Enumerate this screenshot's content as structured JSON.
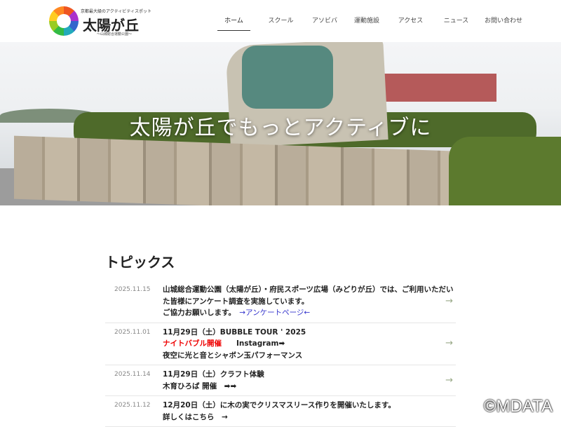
{
  "logo": {
    "tagline": "京都最大級のアクティビティスポット",
    "title": "太陽が丘",
    "subtitle": "〜山城総合運動公園〜"
  },
  "nav": [
    "ホーム",
    "スクール",
    "アソビバ",
    "運動施設",
    "アクセス",
    "ニュース",
    "お問い合わせ"
  ],
  "hero": {
    "text": "太陽が丘でもっとアクティブに"
  },
  "topics": {
    "title": "トピックス",
    "items": [
      {
        "date": "2025.11.15",
        "lines": [
          "山城総合運動公園（太陽が丘）・府民スポーツ広場（みどりが丘）では、ご利用いただいた皆様にアンケート調査を実施しています。",
          "ご協力お願いします。"
        ],
        "link": "→アンケートページ←"
      },
      {
        "date": "2025.11.01",
        "line1": "11月29日（土）BUBBLE TOUR ' 2025",
        "red": "ナイトバブル開催",
        "insta": "Instagram➡",
        "line3": "夜空に光と音とシャボン玉パフォーマンス"
      },
      {
        "date": "2025.11.14",
        "line1": "11月29日（土）クラフト体験",
        "line2": "木育ひろば 開催　➡➡"
      },
      {
        "date": "2025.11.12",
        "line1": "12月20日（土）に木の実でクリスマスリース作りを開催いたします。",
        "line2": "詳しくはこちら　→"
      }
    ],
    "arrow": "→"
  },
  "watermark": "©MDATA"
}
